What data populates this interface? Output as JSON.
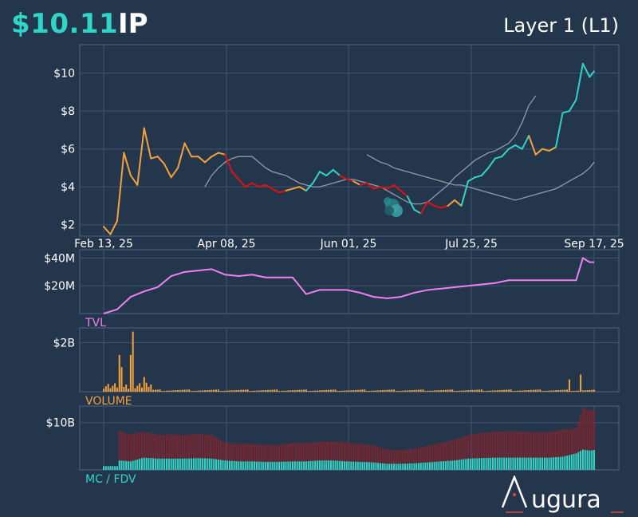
{
  "header": {
    "price": "$10.11",
    "symbol": "IP",
    "category": "Layer 1 (L1)"
  },
  "brand": {
    "name": "ugura",
    "logo_letter": "A"
  },
  "colors": {
    "background": "#24364b",
    "grid": "#3d5470",
    "price_up": "#2fd6c8",
    "price_neutral": "#f5a13c",
    "price_down": "#e01010",
    "ma": "#a4adba",
    "tvl": "#ee82ee",
    "volume": "#f5a13c",
    "mc": "#2fd6c8",
    "fdv": "#7a2630"
  },
  "chart_data": [
    {
      "type": "line",
      "panel": "price",
      "x_ticks": [
        "Feb 13, 25",
        "Apr 08, 25",
        "Jun 01, 25",
        "Jul 25, 25",
        "Sep 17, 25"
      ],
      "y_ticks": [
        "$2",
        "$4",
        "$6",
        "$8",
        "$10"
      ],
      "ylim": [
        1.4,
        11.5
      ],
      "x": [
        0,
        3,
        6,
        9,
        12,
        15,
        18,
        21,
        24,
        27,
        30,
        33,
        36,
        39,
        42,
        45,
        48,
        51,
        54,
        57,
        60,
        63,
        66,
        69,
        72,
        75,
        78,
        81,
        84,
        87,
        90,
        93,
        96,
        99,
        102,
        105,
        108,
        111,
        114,
        117,
        120,
        123,
        126,
        129,
        132,
        135,
        138,
        141,
        144,
        147,
        150,
        153,
        156,
        159,
        162,
        165,
        168,
        171,
        174,
        177,
        180,
        183,
        186,
        189,
        192,
        195,
        198,
        201,
        204,
        207,
        210,
        213,
        216,
        218
      ],
      "price": [
        1.9,
        1.5,
        2.2,
        5.8,
        4.6,
        4.1,
        7.1,
        5.5,
        5.6,
        5.2,
        4.5,
        5.0,
        6.3,
        5.6,
        5.6,
        5.3,
        5.6,
        5.8,
        5.7,
        4.8,
        4.4,
        4.0,
        4.2,
        4.0,
        4.1,
        3.9,
        3.7,
        3.8,
        3.9,
        4.0,
        3.8,
        4.2,
        4.8,
        4.6,
        4.9,
        4.6,
        4.4,
        4.3,
        4.1,
        4.2,
        3.9,
        4.0,
        3.9,
        4.1,
        3.8,
        3.5,
        2.8,
        2.6,
        3.2,
        3.0,
        2.9,
        3.0,
        3.3,
        3.0,
        4.3,
        4.5,
        4.6,
        5.0,
        5.5,
        5.6,
        6.0,
        6.2,
        6.0,
        6.7,
        5.7,
        6.0,
        5.9,
        6.1,
        7.9,
        8.0,
        8.6,
        10.5,
        9.8,
        10.1
      ],
      "price_color": [
        "n",
        "n",
        "n",
        "n",
        "n",
        "n",
        "n",
        "n",
        "n",
        "n",
        "n",
        "n",
        "n",
        "n",
        "n",
        "n",
        "n",
        "n",
        "n",
        "d",
        "d",
        "d",
        "d",
        "d",
        "d",
        "d",
        "d",
        "d",
        "n",
        "n",
        "n",
        "u",
        "u",
        "u",
        "u",
        "u",
        "d",
        "d",
        "n",
        "d",
        "d",
        "d",
        "d",
        "d",
        "d",
        "d",
        "u",
        "u",
        "d",
        "d",
        "d",
        "d",
        "n",
        "n",
        "u",
        "u",
        "u",
        "u",
        "u",
        "u",
        "u",
        "u",
        "u",
        "u",
        "n",
        "n",
        "n",
        "n",
        "u",
        "u",
        "u",
        "u",
        "u",
        "u"
      ],
      "ma_fast_from": 15,
      "ma_fast": [
        4.0,
        4.6,
        5.0,
        5.3,
        5.5,
        5.6,
        5.6,
        5.6,
        5.3,
        5.0,
        4.8,
        4.7,
        4.6,
        4.4,
        4.2,
        4.1,
        4.0,
        4.0,
        4.1,
        4.2,
        4.3,
        4.4,
        4.4,
        4.3,
        4.2,
        4.1,
        4.0,
        3.8,
        3.6,
        3.4,
        3.2,
        3.1,
        3.1,
        3.2,
        3.5,
        3.8,
        4.1,
        4.5,
        4.8,
        5.1,
        5.4,
        5.6,
        5.8,
        5.9,
        6.1,
        6.3,
        6.7,
        7.4,
        8.3,
        8.8
      ],
      "ma_slow_from": 39,
      "ma_slow": [
        5.7,
        5.5,
        5.3,
        5.2,
        5.0,
        4.9,
        4.8,
        4.7,
        4.6,
        4.5,
        4.4,
        4.3,
        4.2,
        4.1,
        4.1,
        4.0,
        3.9,
        3.8,
        3.7,
        3.6,
        3.5,
        3.4,
        3.3,
        3.4,
        3.5,
        3.6,
        3.7,
        3.8,
        3.9,
        4.1,
        4.3,
        4.5,
        4.7,
        5.0,
        5.3,
        5.5,
        5.7,
        5.9,
        6.2,
        6.7,
        7.1
      ]
    },
    {
      "type": "line",
      "panel": "tvl",
      "title": "TVL",
      "y_ticks": [
        "$20M",
        "$40M"
      ],
      "ylim": [
        0,
        46
      ],
      "x": [
        0,
        6,
        12,
        18,
        24,
        30,
        36,
        42,
        48,
        54,
        60,
        66,
        72,
        78,
        84,
        90,
        96,
        102,
        108,
        114,
        120,
        126,
        132,
        138,
        144,
        150,
        156,
        162,
        168,
        174,
        180,
        186,
        192,
        198,
        204,
        210,
        213,
        216,
        218
      ],
      "tvl": [
        0,
        3,
        12,
        16,
        19,
        27,
        30,
        31,
        32,
        28,
        27,
        28,
        26,
        26,
        26,
        14,
        17,
        17,
        17,
        15,
        12,
        11,
        12,
        15,
        17,
        18,
        19,
        20,
        21,
        22,
        24,
        24,
        24,
        24,
        24,
        24,
        40,
        37,
        37
      ]
    },
    {
      "type": "bar",
      "panel": "volume",
      "title": "VOLUME",
      "y_ticks": [
        "$2B"
      ],
      "ylim": [
        0,
        2.6
      ],
      "spikes": {
        "x": [
          7,
          8,
          12,
          13,
          18,
          207,
          212
        ],
        "volume": [
          1.5,
          1.0,
          1.5,
          2.45,
          0.6,
          0.5,
          0.7
        ]
      },
      "typical_volume_b": 0.05
    },
    {
      "type": "bar",
      "panel": "mc_fdv",
      "title": "MC / FDV",
      "y_ticks": [
        "$10B"
      ],
      "ylim": [
        0,
        13.5
      ],
      "x": [
        0,
        6,
        7,
        12,
        18,
        24,
        30,
        36,
        42,
        48,
        54,
        60,
        66,
        72,
        78,
        84,
        90,
        96,
        102,
        108,
        114,
        120,
        126,
        132,
        138,
        144,
        150,
        156,
        162,
        168,
        174,
        180,
        186,
        192,
        198,
        204,
        210,
        213,
        216,
        218
      ],
      "mc": [
        0.8,
        0.8,
        2.0,
        1.8,
        2.6,
        2.4,
        2.4,
        2.4,
        2.5,
        2.4,
        2.0,
        1.8,
        1.8,
        1.7,
        1.7,
        1.8,
        1.8,
        2.0,
        2.0,
        1.8,
        1.7,
        1.6,
        1.3,
        1.3,
        1.4,
        1.6,
        1.8,
        2.0,
        2.4,
        2.5,
        2.6,
        2.6,
        2.6,
        2.6,
        2.6,
        2.8,
        3.5,
        4.3,
        4.1,
        4.2
      ],
      "fdv": [
        0.8,
        0.8,
        8.3,
        7.5,
        8.1,
        7.4,
        7.5,
        7.4,
        7.6,
        7.4,
        5.8,
        5.5,
        5.5,
        5.3,
        5.3,
        5.7,
        5.7,
        6.0,
        6.0,
        5.8,
        5.5,
        5.2,
        4.3,
        4.2,
        4.5,
        5.1,
        5.7,
        6.4,
        7.4,
        7.8,
        8.1,
        8.2,
        8.1,
        8.0,
        8.0,
        8.5,
        8.8,
        13.2,
        12.5,
        12.7
      ]
    }
  ]
}
